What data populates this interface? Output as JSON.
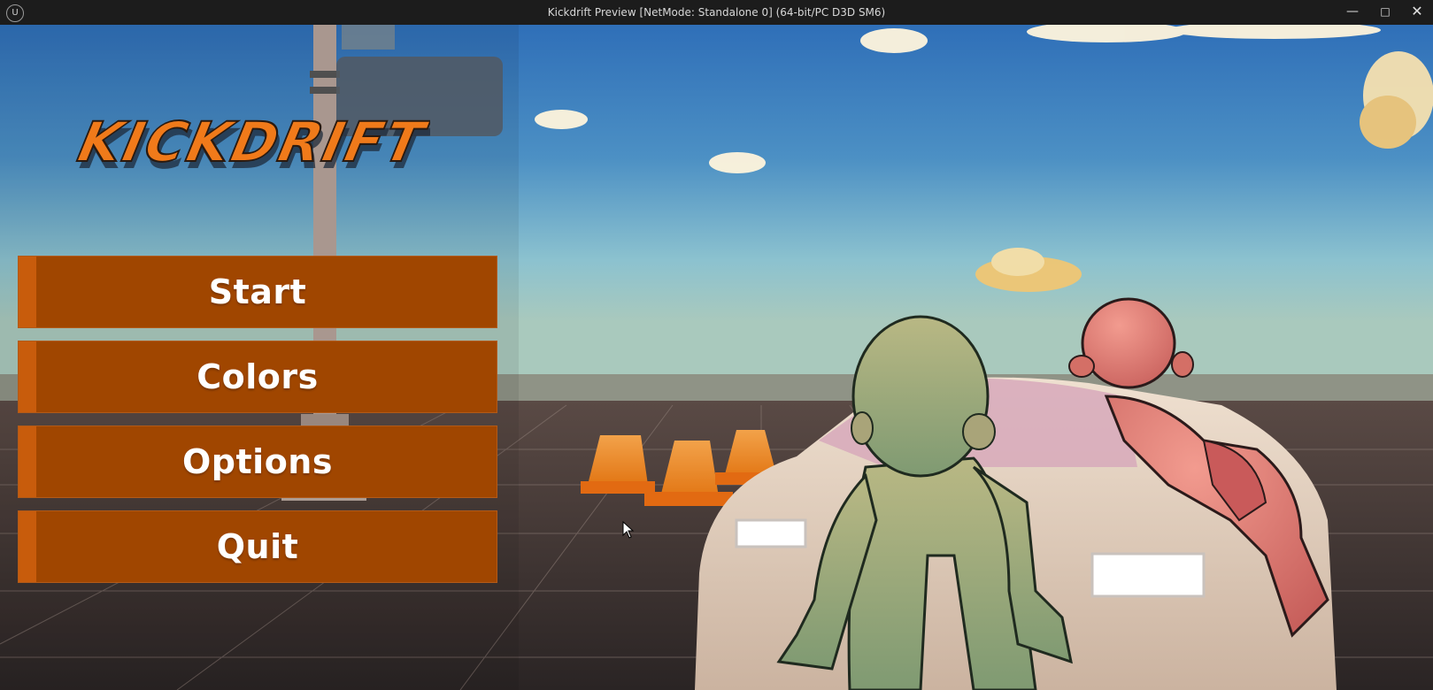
{
  "window": {
    "title": "Kickdrift Preview [NetMode: Standalone 0]  (64-bit/PC D3D SM6)",
    "logo_text": "U"
  },
  "game": {
    "logo_text": "KICKDRIFT",
    "brand_color": "#f07a1a"
  },
  "menu": {
    "buttons": [
      {
        "label": "Start"
      },
      {
        "label": "Colors"
      },
      {
        "label": "Options"
      },
      {
        "label": "Quit"
      }
    ],
    "button_color": "#a04600",
    "accent_color": "#c85c0c"
  },
  "icons": {
    "minimize": "minimize-icon",
    "maximize": "maximize-icon",
    "close": "close-icon",
    "cursor": "mouse-pointer-icon"
  }
}
